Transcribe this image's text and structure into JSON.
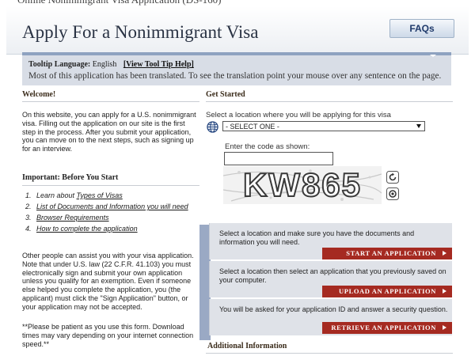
{
  "window": {
    "partial_title": "Online Nonimmigrant Visa Application (DS-160)"
  },
  "header": {
    "title": "Apply For a Nonimmigrant Visa",
    "faq_label": "FAQs"
  },
  "tooltip": {
    "language_label": "Tooltip Language:",
    "language_value": "English",
    "help_link": "[View Tool Tip Help]",
    "note": "Most of this application has been translated. To see the translation point your mouse over any sentence on the page."
  },
  "welcome": {
    "heading": "Welcome!",
    "body": "On this website, you can apply for a U.S. nonimmigrant visa. Filling out the application on our site is the first step in the process. After you submit your application, you can move on to the next steps, such as signing up for an interview."
  },
  "important": {
    "heading": "Important: Before You Start",
    "links": [
      {
        "num": "1.",
        "prefix": "Learn about ",
        "link": "Types of Visas"
      },
      {
        "num": "2.",
        "prefix": "",
        "link": "List of Documents and Information you will need"
      },
      {
        "num": "3.",
        "prefix": "",
        "link": "Browser Requirements"
      },
      {
        "num": "4.",
        "prefix": "",
        "link": "How to complete the application"
      }
    ],
    "assist_text": "Other people can assist you with your visa application. Note that under U.S. law (22 C.F.R. 41.103) you must electronically sign and submit your own application unless you qualify for an exemption. Even if someone else helped you complete the application, you (the applicant) must click the \"Sign Application\" button, or your application may not be accepted.",
    "patience_text": "**Please be patient as you use this form. Download times may vary depending on your internet connection speed.**"
  },
  "get_started": {
    "heading": "Get Started",
    "location_label": "Select a location where you will be applying for this visa",
    "location_selected": "- SELECT ONE -",
    "code_label": "Enter the code as shown:",
    "code_value": "",
    "captcha_text": "KW865"
  },
  "actions": [
    {
      "text": "Select a location and make sure you have the documents and information you will need.",
      "button": "START AN APPLICATION"
    },
    {
      "text": "Select a location then select an application that you previously saved on your computer.",
      "button": "UPLOAD AN APPLICATION"
    },
    {
      "text": "You will be asked for your application ID and answer a security question.",
      "button": "RETRIEVE AN APPLICATION"
    }
  ],
  "additional": {
    "heading": "Additional Information"
  },
  "colors": {
    "action_button": "#a52a21",
    "tooltip_bg": "#d8dde6",
    "action_box_bg": "#dfe2e8",
    "faq_text": "#1f3a6b"
  },
  "icons": {
    "globe": "globe-icon",
    "refresh": "refresh-icon",
    "audio": "audio-icon",
    "caret": "caret-right-icon"
  }
}
